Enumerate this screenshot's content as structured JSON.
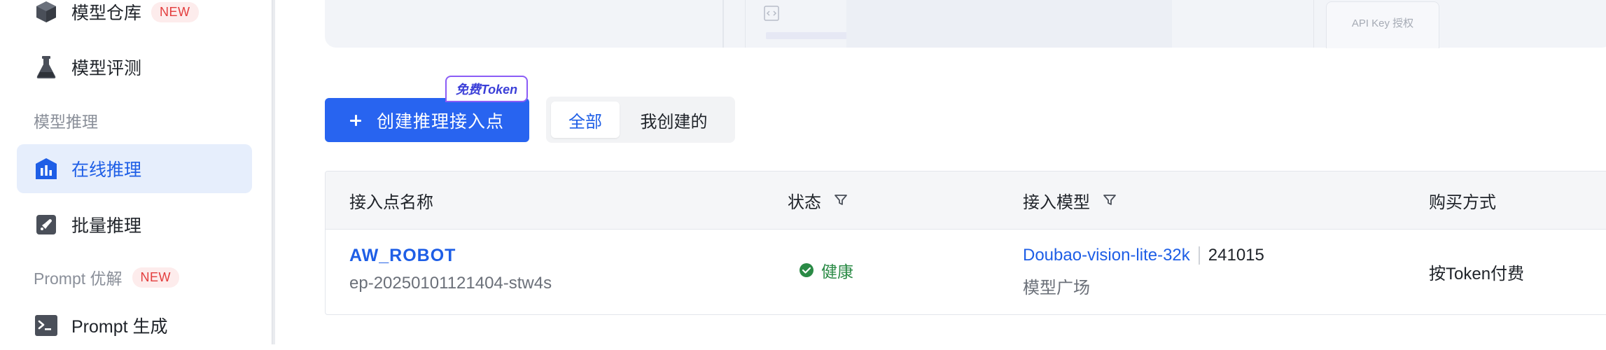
{
  "sidebar": {
    "items": [
      {
        "label": "模型仓库",
        "badge": "NEW",
        "icon": "cube-icon"
      },
      {
        "label": "模型评测",
        "icon": "flask-icon"
      },
      {
        "label": "在线推理",
        "icon": "chart-building-icon",
        "active": true
      },
      {
        "label": "批量推理",
        "icon": "rocket-icon"
      },
      {
        "label": "Prompt 生成",
        "icon": "terminal-icon"
      }
    ],
    "groups": [
      {
        "label": "模型推理"
      },
      {
        "label": "Prompt 优解",
        "badge": "NEW"
      }
    ]
  },
  "top_card": {
    "api_key_tab": "API Key 授权"
  },
  "toolbar": {
    "create_label": "创建推理接入点",
    "free_tag": "免费Token",
    "filter_all": "全部",
    "filter_mine": "我创建的"
  },
  "table": {
    "columns": [
      "接入点名称",
      "状态",
      "接入模型",
      "购买方式"
    ],
    "rows": [
      {
        "name": "AW_ROBOT",
        "id": "ep-20250101121404-stw4s",
        "status": "健康",
        "model": "Doubao-vision-lite-32k",
        "model_version": "241015",
        "model_source": "模型广场",
        "purchase": "按Token付费"
      }
    ]
  },
  "colors": {
    "accent": "#2864f0",
    "active_bg": "#e6eefc",
    "badge_red": "#e33e3e",
    "healthy_green": "#2a8a45"
  }
}
